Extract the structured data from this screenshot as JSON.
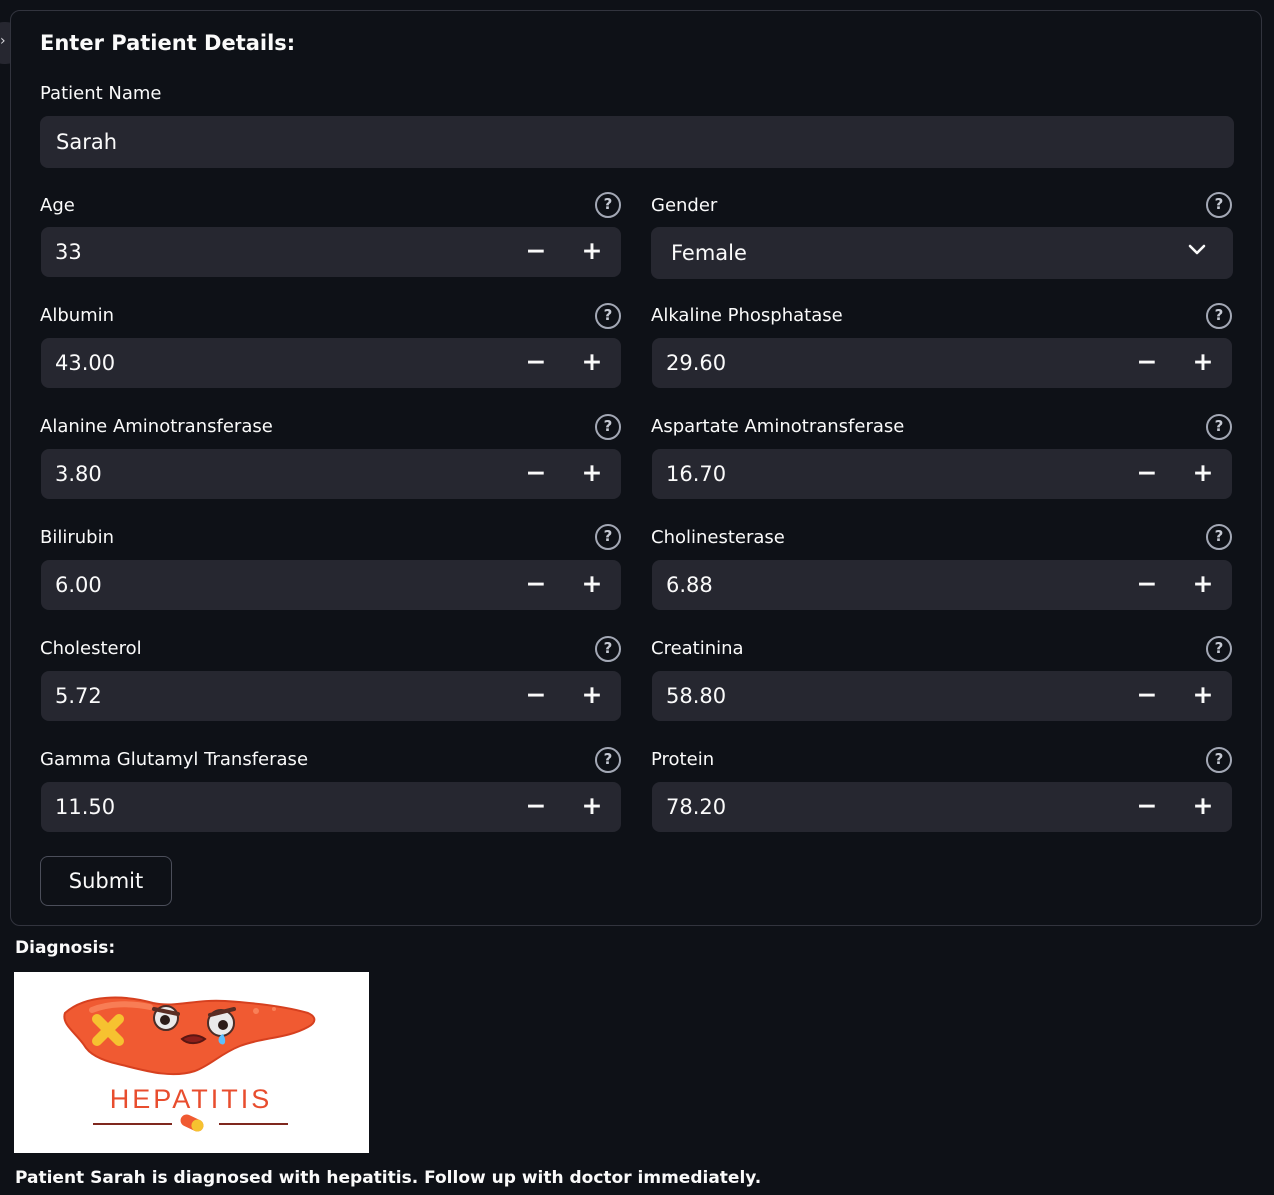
{
  "side_tab": {
    "glyph": "›"
  },
  "form": {
    "title": "Enter Patient Details:",
    "patient_name": {
      "label": "Patient Name",
      "value": "Sarah"
    },
    "age": {
      "label": "Age",
      "value": "33"
    },
    "gender": {
      "label": "Gender",
      "value": "Female"
    },
    "albumin": {
      "label": "Albumin",
      "value": "43.00"
    },
    "alkaline_phosphatase": {
      "label": "Alkaline Phosphatase",
      "value": "29.60"
    },
    "alanine_aminotransferase": {
      "label": "Alanine Aminotransferase",
      "value": "3.80"
    },
    "aspartate_aminotransferase": {
      "label": "Aspartate Aminotransferase",
      "value": "16.70"
    },
    "bilirubin": {
      "label": "Bilirubin",
      "value": "6.00"
    },
    "cholinesterase": {
      "label": "Cholinesterase",
      "value": "6.88"
    },
    "cholesterol": {
      "label": "Cholesterol",
      "value": "5.72"
    },
    "creatinina": {
      "label": "Creatinina",
      "value": "58.80"
    },
    "gamma_glutamyl_transferase": {
      "label": "Gamma Glutamyl Transferase",
      "value": "11.50"
    },
    "protein": {
      "label": "Protein",
      "value": "78.20"
    },
    "help_icon": "?",
    "minus_icon": "−",
    "plus_icon": "+",
    "submit_label": "Submit"
  },
  "diagnosis": {
    "title": "Diagnosis:",
    "image_label": "HEPATITIS",
    "message": "Patient Sarah is diagnosed with hepatitis. Follow up with doctor immediately."
  },
  "icons": {
    "help": "help-icon",
    "minus": "minus-icon",
    "plus": "plus-icon",
    "chevron": "chevron-down-icon",
    "liver": "liver-illustration",
    "pill": "pill-icon"
  },
  "colors": {
    "background": "#0e1117",
    "input_background": "#262730",
    "text": "#fafafa",
    "form_border": "#32343e",
    "liver_orange": "#f05a32",
    "hepatitis_text": "#e84d2e"
  }
}
